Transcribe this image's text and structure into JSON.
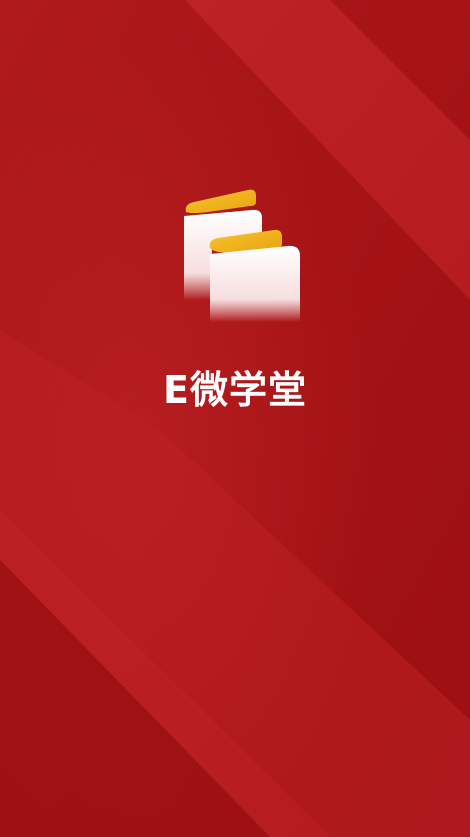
{
  "app": {
    "name": "E微学堂",
    "logo_icon": "e-book-logo-icon"
  },
  "colors": {
    "background_dark": "#a21114",
    "background_light": "#bf2024",
    "logo_yellow": "#f2b51b",
    "logo_white": "#ffffff",
    "text": "#ffffff"
  }
}
